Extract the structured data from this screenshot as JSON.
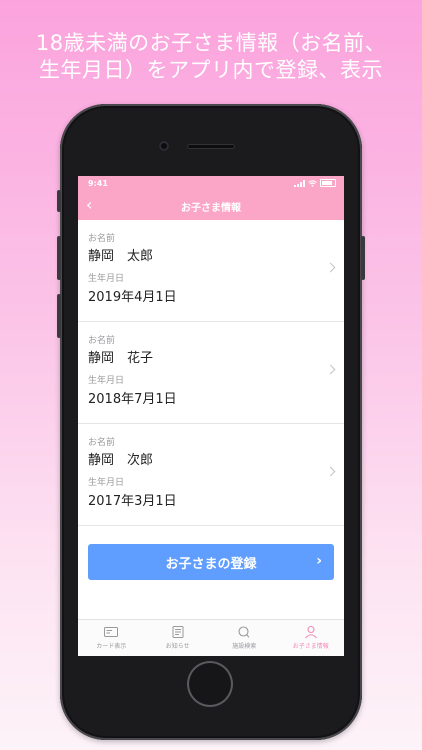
{
  "headline": {
    "line1": "18歳未満のお子さま情報（お名前、",
    "line2": "生年月日）をアプリ内で登録、表示"
  },
  "status_bar": {
    "time": "9:41"
  },
  "nav": {
    "back_icon": "chevron-left-icon",
    "title": "お子さま情報"
  },
  "children": [
    {
      "name_label": "お名前",
      "name": "静岡　太郎",
      "birth_label": "生年月日",
      "birth": "2019年4月1日"
    },
    {
      "name_label": "お名前",
      "name": "静岡　花子",
      "birth_label": "生年月日",
      "birth": "2018年7月1日"
    },
    {
      "name_label": "お名前",
      "name": "静岡　次郎",
      "birth_label": "生年月日",
      "birth": "2017年3月1日"
    }
  ],
  "register_button": {
    "label": "お子さまの登録",
    "arrow": "›"
  },
  "tabbar": {
    "items": [
      {
        "label": "カード表示",
        "icon": "card-icon"
      },
      {
        "label": "お知らせ",
        "icon": "news-icon"
      },
      {
        "label": "施設検索",
        "icon": "search-icon"
      },
      {
        "label": "お子さま情報",
        "icon": "person-icon",
        "active": true
      }
    ]
  },
  "colors": {
    "nav_pink": "#fba6c6",
    "button_blue": "#5f9dff",
    "active_tab": "#f18bb7"
  }
}
